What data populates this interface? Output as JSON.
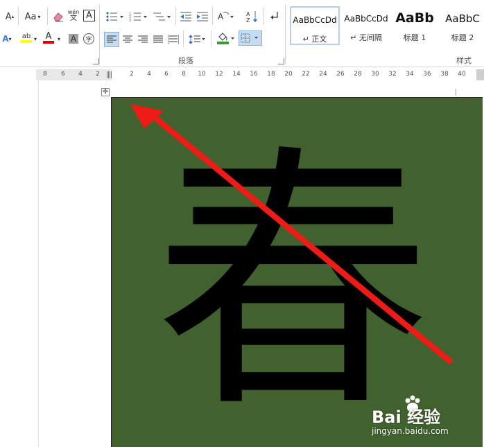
{
  "ribbon": {
    "font_group": {
      "grow_font": "A",
      "change_case": "Aa",
      "phonetic_top": "wén",
      "phonetic_bottom": "文",
      "char_border": "A",
      "text_effects": "A",
      "highlight": "ab",
      "font_color": "A",
      "char_shading": "A",
      "enclose_char": "字"
    },
    "paragraph_group_label": "段落",
    "styles_group_label": "样式",
    "styles": [
      {
        "sample": "AaBbCcDd",
        "name": "↵ 正文"
      },
      {
        "sample": "AaBbCcDd",
        "name": "↵ 无间隔"
      },
      {
        "sample": "AaBb",
        "name": "标题 1"
      },
      {
        "sample": "AaBbC",
        "name": "标题 2"
      }
    ]
  },
  "ruler": {
    "left_numbers": [
      "8",
      "6",
      "4",
      "2"
    ],
    "right_numbers": [
      "2",
      "4",
      "6",
      "8",
      "10",
      "12",
      "14",
      "16",
      "18",
      "20",
      "22",
      "24",
      "26",
      "28",
      "30",
      "32",
      "34",
      "36",
      "38",
      "40"
    ]
  },
  "document": {
    "character": "春",
    "background_color": "#41622f",
    "arrow_color": "#ee1c16"
  },
  "watermark": {
    "brand": "Bai 经验",
    "url": "jingyan.baidu.com"
  }
}
